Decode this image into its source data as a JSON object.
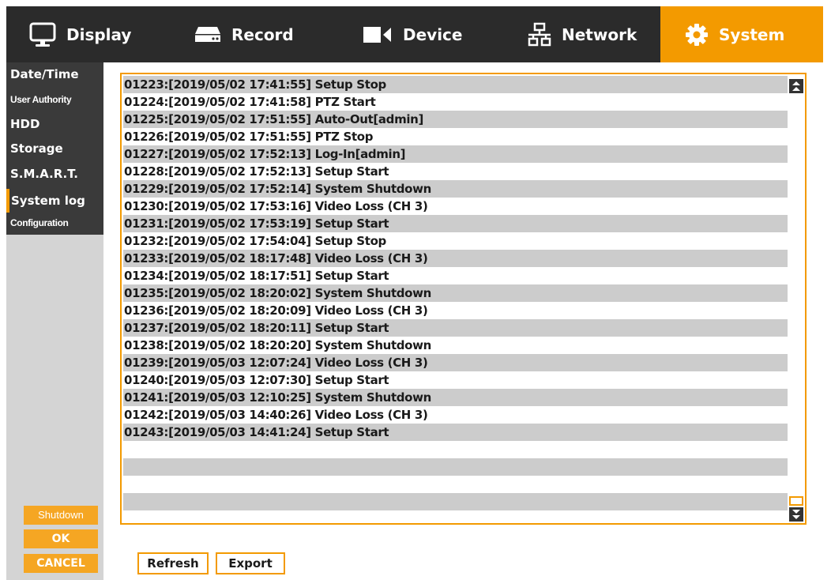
{
  "nav": {
    "tabs": [
      {
        "label": "Display",
        "icon": "monitor-icon"
      },
      {
        "label": "Record",
        "icon": "hdd-recorder-icon"
      },
      {
        "label": "Device",
        "icon": "camera-icon"
      },
      {
        "label": "Network",
        "icon": "network-icon"
      },
      {
        "label": "System",
        "icon": "gear-icon"
      }
    ],
    "active_tab": "System"
  },
  "sidebar": {
    "items": [
      {
        "label": "Date/Time"
      },
      {
        "label": "User Authority"
      },
      {
        "label": "HDD"
      },
      {
        "label": "Storage"
      },
      {
        "label": "S.M.A.R.T."
      },
      {
        "label": "System log"
      },
      {
        "label": "Configuration"
      }
    ],
    "active_item": "System log",
    "shutdown_label": "Shutdown",
    "ok_label": "OK",
    "cancel_label": "CANCEL"
  },
  "log": {
    "entries": [
      "01223:[2019/05/02 17:41:55] Setup Stop",
      "01224:[2019/05/02 17:41:58] PTZ Start",
      "01225:[2019/05/02 17:51:55] Auto-Out[admin]",
      "01226:[2019/05/02 17:51:55] PTZ Stop",
      "01227:[2019/05/02 17:52:13] Log-In[admin]",
      "01228:[2019/05/02 17:52:13] Setup Start",
      "01229:[2019/05/02 17:52:14] System Shutdown",
      "01230:[2019/05/02 17:53:16] Video Loss (CH 3)",
      "01231:[2019/05/02 17:53:19] Setup Start",
      "01232:[2019/05/02 17:54:04] Setup Stop",
      "01233:[2019/05/02 18:17:48] Video Loss (CH 3)",
      "01234:[2019/05/02 18:17:51] Setup Start",
      "01235:[2019/05/02 18:20:02] System Shutdown",
      "01236:[2019/05/02 18:20:09] Video Loss (CH 3)",
      "01237:[2019/05/02 18:20:11] Setup Start",
      "01238:[2019/05/02 18:20:20] System Shutdown",
      "01239:[2019/05/03 12:07:24] Video Loss (CH 3)",
      "01240:[2019/05/03 12:07:30] Setup Start",
      "01241:[2019/05/03 12:10:25] System Shutdown",
      "01242:[2019/05/03 14:40:26] Video Loss (CH 3)",
      "01243:[2019/05/03 14:41:24] Setup Start",
      "",
      "",
      "",
      ""
    ]
  },
  "footer": {
    "refresh_label": "Refresh",
    "export_label": "Export"
  },
  "colors": {
    "accent": "#f39a00",
    "nav_bg": "#2b2b2b",
    "sidebar_menu_bg": "#3a3a3a",
    "sidebar_bg": "#d4d4d4",
    "row_shade": "#cccccc"
  }
}
